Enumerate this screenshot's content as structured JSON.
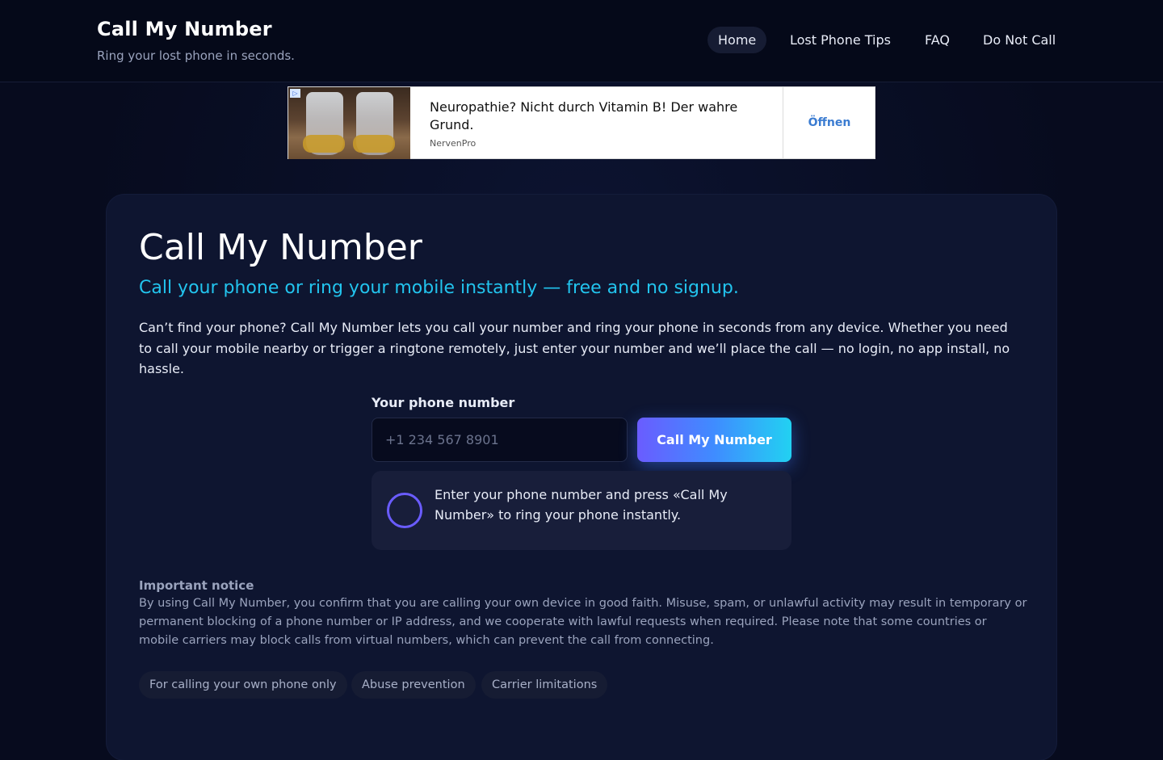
{
  "header": {
    "title": "Call My Number",
    "tagline": "Ring your lost phone in seconds.",
    "nav": [
      "Home",
      "Lost Phone Tips",
      "FAQ",
      "Do Not Call"
    ],
    "active_nav": "Home"
  },
  "ad": {
    "headline": "Neuropathie? Nicht durch Vitamin B! Der wahre Grund.",
    "source": "NervenPro",
    "cta": "Öffnen",
    "badge": "▷"
  },
  "main": {
    "title": "Call My Number",
    "subtitle": "Call your phone or ring your mobile instantly — free and no signup.",
    "intro": "Can’t find your phone? Call My Number lets you call your number and ring your phone in seconds from any device. Whether you need to call your mobile nearby or trigger a ringtone remotely, just enter your number and we’ll place the call — no login, no app install, no hassle.",
    "form": {
      "label": "Your phone number",
      "placeholder": "+1 234 567 8901",
      "value": "",
      "button": "Call My Number"
    },
    "status": "Enter your phone number and press «Call My Number» to ring your phone instantly.",
    "notice": {
      "title": "Important notice",
      "body": "By using Call My Number, you confirm that you are calling your own device in good faith. Misuse, spam, or unlawful activity may result in temporary or permanent blocking of a phone number or IP address, and we cooperate with lawful requests when required. Please note that some countries or mobile carriers may block calls from virtual numbers, which can prevent the call from connecting."
    },
    "chips": [
      "For calling your own phone only",
      "Abuse prevention",
      "Carrier limitations"
    ]
  },
  "colors": {
    "background": "#070b1e",
    "accent_cyan": "#22c4ee",
    "accent_purple": "#6a5cff"
  }
}
